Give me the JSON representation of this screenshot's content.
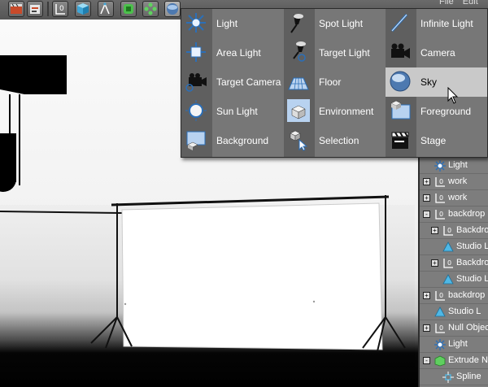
{
  "toolbar": {
    "buttons": [
      {
        "name": "render-view-icon"
      },
      {
        "name": "render-settings-icon"
      },
      {
        "name": "null-object-icon"
      },
      {
        "name": "cube-icon"
      },
      {
        "name": "spline-pen-icon"
      },
      {
        "name": "subdivision-icon"
      },
      {
        "name": "array-icon"
      },
      {
        "name": "scene-objects-icon"
      }
    ],
    "menu": [
      "File",
      "Edit"
    ]
  },
  "popup_menu": {
    "columns": [
      {
        "items": [
          {
            "label": "Light",
            "icon": "light-icon"
          },
          {
            "label": "Area Light",
            "icon": "area-light-icon"
          },
          {
            "label": "Target Camera",
            "icon": "target-camera-icon"
          },
          {
            "label": "Sun Light",
            "icon": "sun-light-icon"
          },
          {
            "label": "Background",
            "icon": "background-icon"
          }
        ]
      },
      {
        "items": [
          {
            "label": "Spot Light",
            "icon": "spot-light-icon"
          },
          {
            "label": "Target Light",
            "icon": "target-light-icon"
          },
          {
            "label": "Floor",
            "icon": "floor-icon"
          },
          {
            "label": "Environment",
            "icon": "environment-icon"
          },
          {
            "label": "Selection",
            "icon": "selection-icon"
          }
        ]
      },
      {
        "items": [
          {
            "label": "Infinite Light",
            "icon": "infinite-light-icon"
          },
          {
            "label": "Camera",
            "icon": "camera-icon"
          },
          {
            "label": "Sky",
            "icon": "sky-icon",
            "highlighted": true
          },
          {
            "label": "Foreground",
            "icon": "foreground-icon"
          },
          {
            "label": "Stage",
            "icon": "stage-icon"
          }
        ]
      }
    ],
    "highlight_color": "#c9c9c9"
  },
  "object_manager": {
    "rows": [
      {
        "label": "Light",
        "indent": 0,
        "icon": "light-icon",
        "expander": ""
      },
      {
        "label": "work",
        "indent": 0,
        "icon": "null-object-icon",
        "expander": "+"
      },
      {
        "label": "work",
        "indent": 0,
        "icon": "null-object-icon",
        "expander": "+"
      },
      {
        "label": "backdrop",
        "indent": 0,
        "icon": "null-object-icon",
        "expander": "-"
      },
      {
        "label": "Backdrop",
        "indent": 1,
        "icon": "null-object-icon",
        "expander": "+"
      },
      {
        "label": "Studio L",
        "indent": 1,
        "icon": "cone-icon",
        "expander": ""
      },
      {
        "label": "Backdrop",
        "indent": 1,
        "icon": "null-object-icon",
        "expander": "+"
      },
      {
        "label": "Studio L",
        "indent": 1,
        "icon": "cone-icon",
        "expander": ""
      },
      {
        "label": "backdrop",
        "indent": 0,
        "icon": "null-object-icon",
        "expander": "+"
      },
      {
        "label": "Studio L",
        "indent": 0,
        "icon": "cone-icon",
        "expander": ""
      },
      {
        "label": "Null Object",
        "indent": 0,
        "icon": "null-object-icon",
        "expander": "+"
      },
      {
        "label": "Light",
        "indent": 0,
        "icon": "light-icon",
        "expander": ""
      },
      {
        "label": "Extrude NU",
        "indent": 0,
        "icon": "extrude-icon",
        "expander": "-"
      },
      {
        "label": "Spline",
        "indent": 1,
        "icon": "spline-icon",
        "expander": ""
      }
    ]
  }
}
